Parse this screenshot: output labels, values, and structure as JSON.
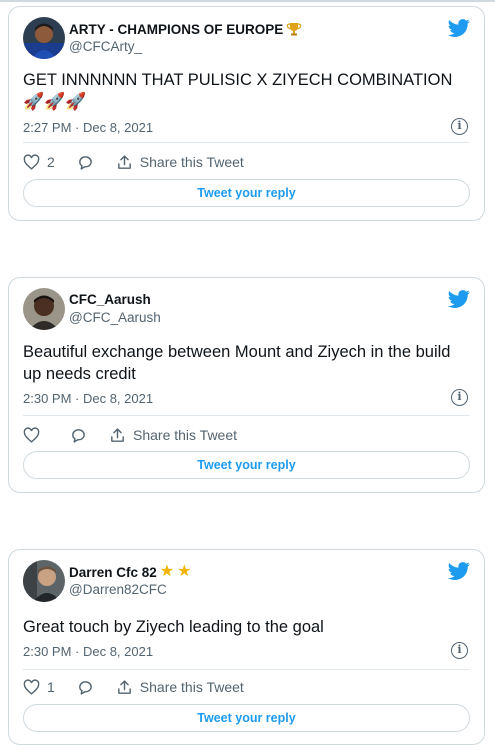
{
  "tweets": [
    {
      "name": "ARTY - CHAMPIONS OF EUROPE",
      "badge": "trophy-emoji",
      "handle": "@CFCArty_",
      "text": "GET INNNNNN THAT PULISIC X ZIYECH COMBINATION",
      "emoji": "🚀🚀🚀",
      "time": "2:27 PM · Dec 8, 2021",
      "likes": "2",
      "share_label": "Share this Tweet",
      "reply_label": "Tweet your reply"
    },
    {
      "name": "CFC_Aarush",
      "handle": "@CFC_Aarush",
      "text": "Beautiful exchange between Mount and Ziyech in the build up needs credit",
      "time": "2:30 PM · Dec 8, 2021",
      "likes": "",
      "share_label": "Share this Tweet",
      "reply_label": "Tweet your reply"
    },
    {
      "name": "Darren Cfc 82",
      "badge": "star-emoji-x2",
      "handle": "@Darren82CFC",
      "text": "Great touch by Ziyech leading to the goal",
      "time": "2:30 PM · Dec 8, 2021",
      "likes": "1",
      "share_label": "Share this Tweet",
      "reply_label": "Tweet your reply"
    }
  ],
  "colors": {
    "twitter_blue": "#1d9bf0",
    "muted": "#536471",
    "border": "#cfd9de",
    "star": "#f4b400",
    "trophy": "#e0a21b"
  }
}
